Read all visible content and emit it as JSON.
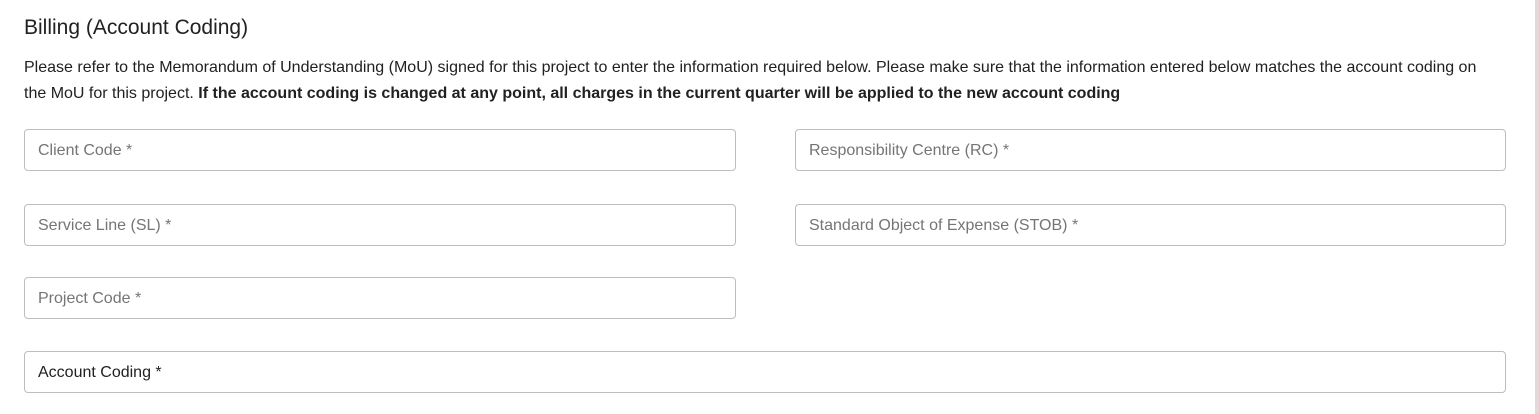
{
  "section": {
    "title": "Billing (Account Coding)",
    "description_plain": "Please refer to the Memorandum of Understanding (MoU) signed for this project to enter the information required below. Please make sure that the information entered below matches the account coding on the MoU for this project. ",
    "description_bold": "If the account coding is changed at any point, all charges in the current quarter will be applied to the new account coding"
  },
  "fields": {
    "client_code": {
      "label": "Client Code *",
      "value": ""
    },
    "responsibility_centre": {
      "label": "Responsibility Centre (RC) *",
      "value": ""
    },
    "service_line": {
      "label": "Service Line (SL) *",
      "value": ""
    },
    "stob": {
      "label": "Standard Object of Expense (STOB) *",
      "value": ""
    },
    "project_code": {
      "label": "Project Code *",
      "value": ""
    },
    "account_coding": {
      "label": "Account Coding *",
      "value": ""
    }
  }
}
